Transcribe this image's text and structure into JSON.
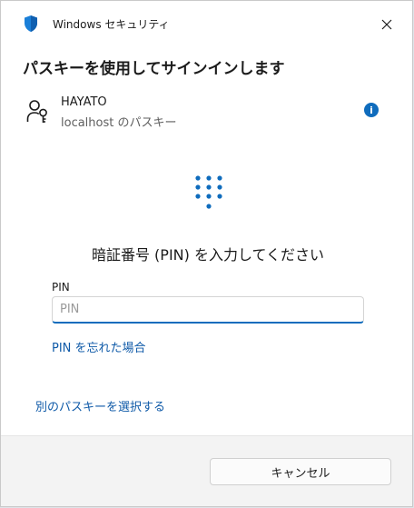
{
  "window": {
    "title": "Windows セキュリティ",
    "heading": "パスキーを使用してサインインします"
  },
  "account": {
    "name": "HAYATO",
    "subtitle": "localhost のパスキー",
    "info_icon_label": "i"
  },
  "pin": {
    "prompt": "暗証番号 (PIN) を入力してください",
    "label": "PIN",
    "placeholder": "PIN",
    "value": ""
  },
  "links": {
    "forgot_pin": "PIN を忘れた場合",
    "choose_other": "別のパスキーを選択する"
  },
  "footer": {
    "cancel_label": "キャンセル"
  },
  "icons": {
    "title": "windows-security-shield-icon",
    "close": "close-icon",
    "account": "user-key-icon",
    "info": "info-icon",
    "keypad": "pin-keypad-icon"
  },
  "colors": {
    "accent": "#0f6cbd",
    "link": "#0f5aa8",
    "footer_bg": "#f3f3f3"
  }
}
